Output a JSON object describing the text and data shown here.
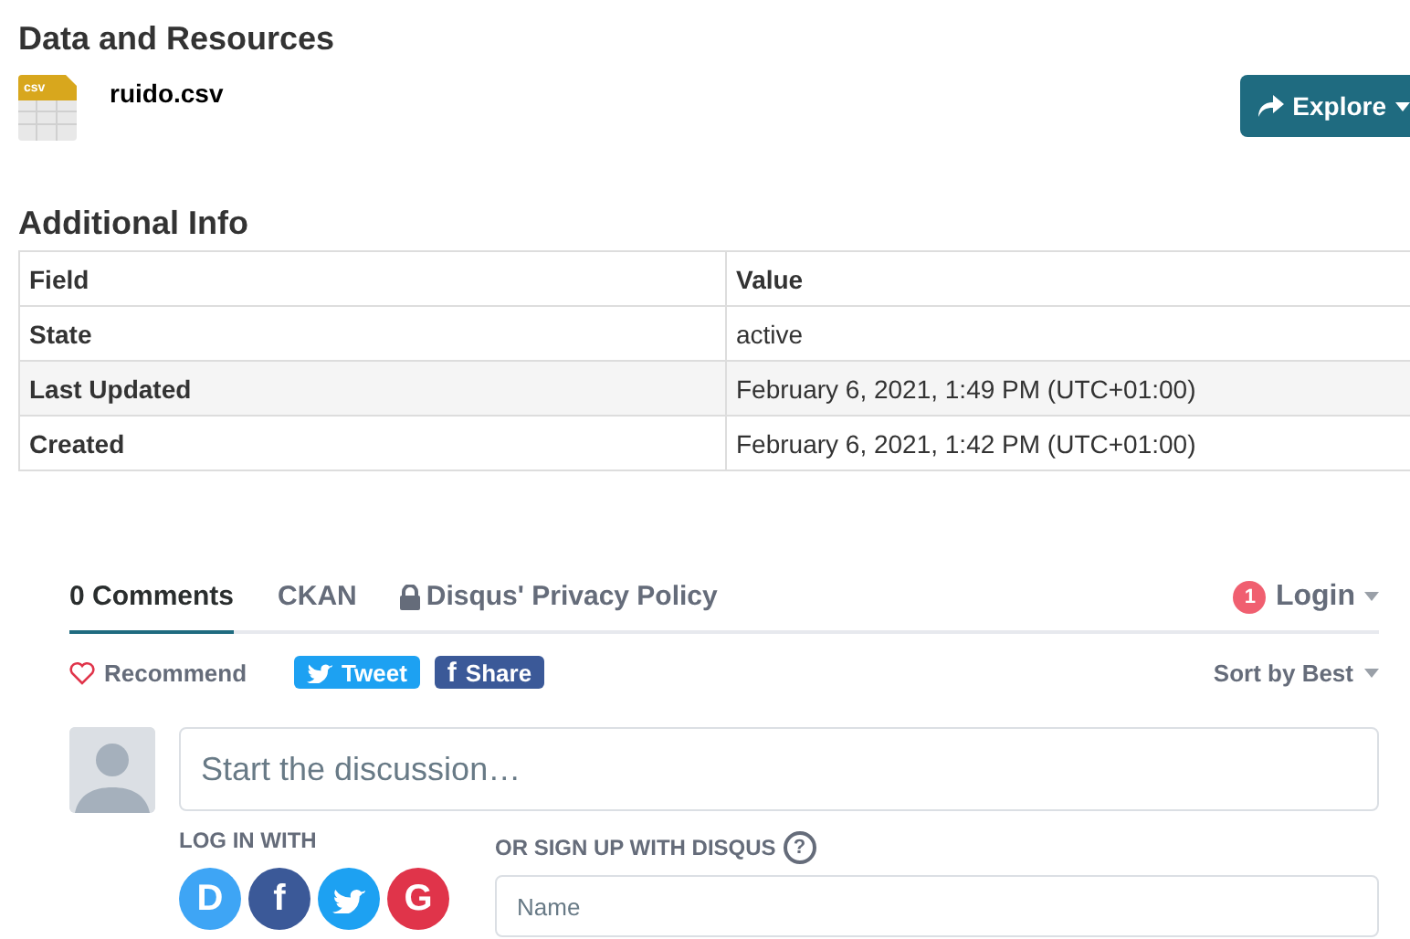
{
  "resources": {
    "title": "Data and Resources",
    "items": [
      {
        "format": "csv",
        "name": "ruido.csv",
        "button": "Explore"
      }
    ]
  },
  "additional_info": {
    "title": "Additional Info",
    "columns": [
      "Field",
      "Value"
    ],
    "rows": [
      {
        "field": "State",
        "value": "active"
      },
      {
        "field": "Last Updated",
        "value": "February 6, 2021, 1:49 PM (UTC+01:00)"
      },
      {
        "field": "Created",
        "value": "February 6, 2021, 1:42 PM (UTC+01:00)"
      }
    ]
  },
  "comments": {
    "tabs": [
      {
        "label": "0 Comments",
        "selected": true
      },
      {
        "label": "CKAN",
        "selected": false
      },
      {
        "label": "Disqus' Privacy Policy",
        "selected": false,
        "kind": "lock"
      }
    ],
    "login": {
      "badge": "1",
      "label": "Login"
    },
    "recommend": "Recommend",
    "tweet": "Tweet",
    "share": {
      "icon": "f",
      "label": "Share"
    },
    "sort": "Sort by Best",
    "composer": {
      "placeholder": "Start the discussion…"
    },
    "log_in_with": "LOG IN WITH",
    "providers": [
      {
        "kind": "letter",
        "label": "D",
        "color": "#3ea5f5"
      },
      {
        "kind": "letter",
        "label": "f",
        "color": "#3b5998"
      },
      {
        "kind": "bird",
        "color": "#1da1f2"
      },
      {
        "kind": "letter",
        "label": "G",
        "color": "#e0344a"
      }
    ],
    "signup": {
      "label": "OR SIGN UP WITH DISQUS",
      "help": "?"
    },
    "name_field": {
      "placeholder": "Name"
    }
  }
}
